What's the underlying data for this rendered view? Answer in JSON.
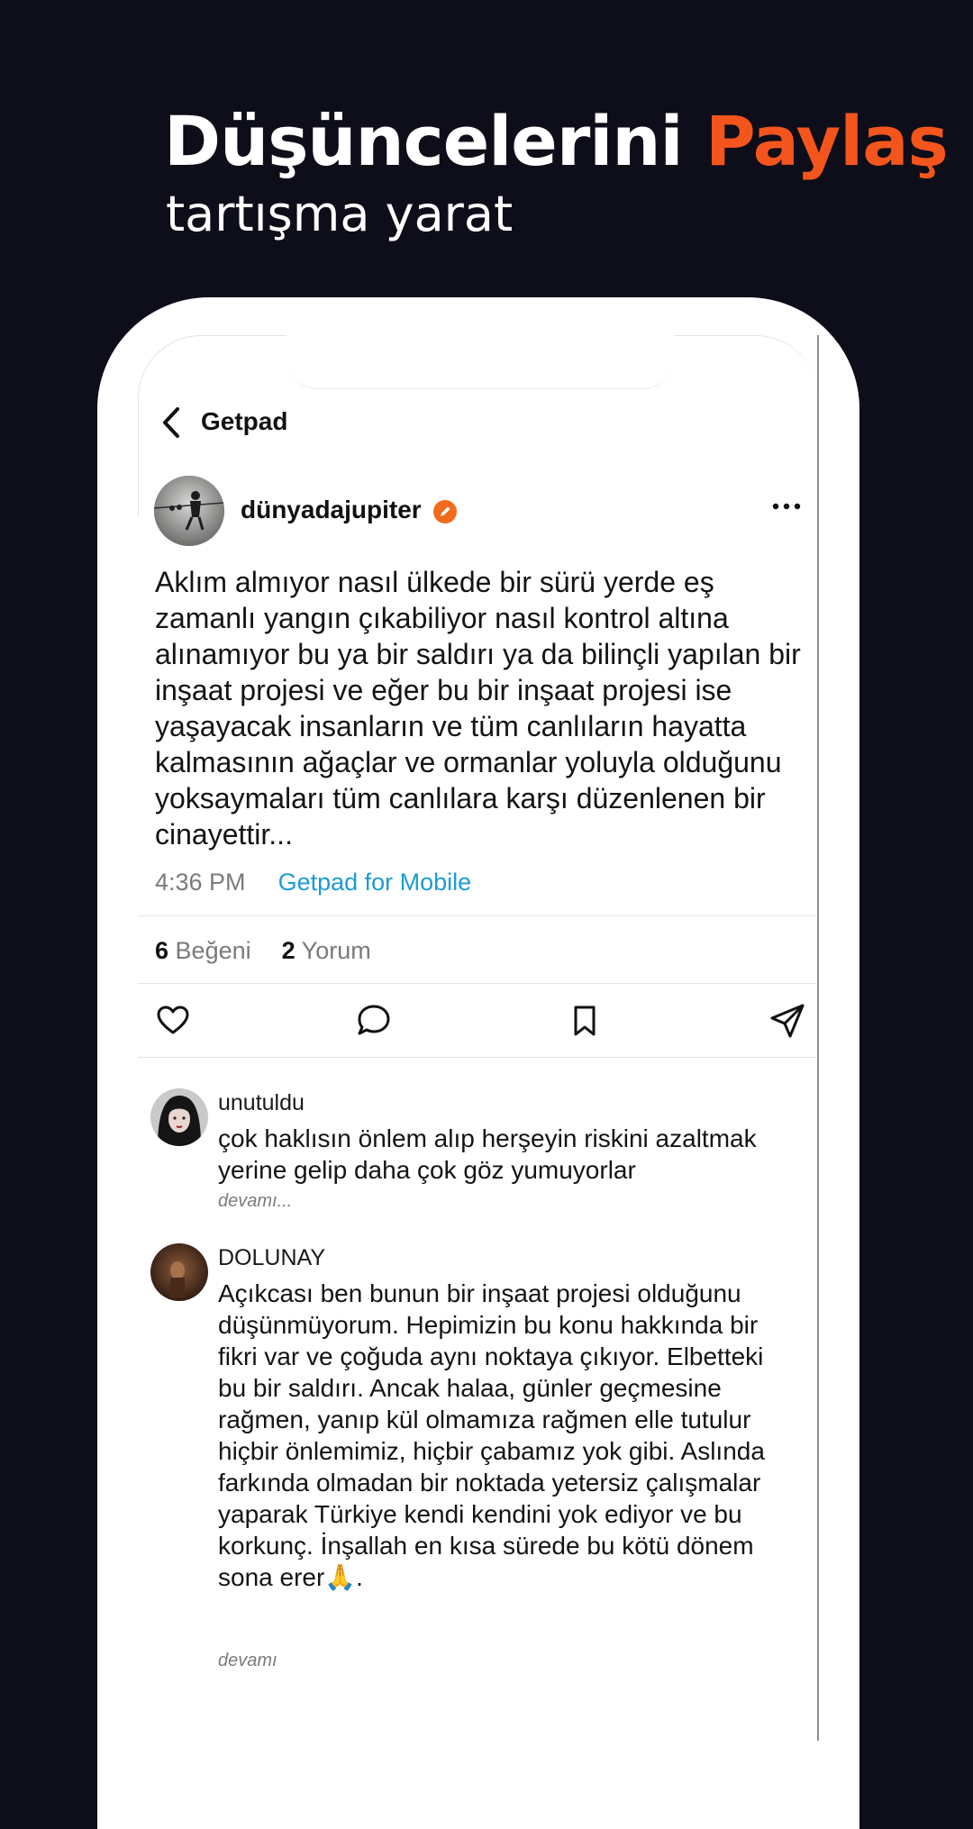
{
  "promo": {
    "headline_main": "Düşüncelerini",
    "headline_accent": "Paylaş",
    "subheadline": "tartışma yarat",
    "accent_color": "#f4551c",
    "background_color": "#0d0e19"
  },
  "nav": {
    "back_icon": "chevron-left-icon",
    "title": "Getpad"
  },
  "post": {
    "author": "dünyadajupiter",
    "verified_icon": "pencil-badge-icon",
    "more_icon": "more-horizontal-icon",
    "text": "Aklım almıyor nasıl ülkede bir sürü yerde eş zamanlı yangın çıkabiliyor nasıl kontrol altına alınamıyor bu ya bir saldırı ya da bilinçli yapılan bir inşaat projesi ve eğer bu bir inşaat projesi ise yaşayacak insanların ve tüm canlıların hayatta kalmasının ağaçlar ve ormanlar yoluyla olduğunu yoksaymaları tüm canlılara karşı düzenlenen bir cinayettir...",
    "time": "4:36 PM",
    "source": "Getpad for Mobile",
    "likes_count": "6",
    "likes_label": "Beğeni",
    "comments_count": "2",
    "comments_label": "Yorum"
  },
  "actions": {
    "like_icon": "heart-icon",
    "comment_icon": "speech-bubble-icon",
    "bookmark_icon": "bookmark-icon",
    "share_icon": "send-icon"
  },
  "comments": [
    {
      "user": "unutuldu",
      "text": "çok haklısın önlem alıp herşeyin riskini azaltmak yerine gelip daha çok göz yumuyorlar",
      "more": "devamı..."
    },
    {
      "user": "DOLUNAY",
      "text": "Açıkcası ben bunun bir inşaat projesi olduğunu düşünmüyorum. Hepimizin bu konu hakkında bir fikri var ve çoğuda aynı noktaya çıkıyor. Elbetteki bu bir saldırı. Ancak halaa, günler geçmesine rağmen, yanıp kül olmamıza rağmen elle tutulur hiçbir önlemimiz, hiçbir çabamız yok gibi. Aslında farkında olmadan bir noktada yetersiz çalışmalar yaparak Türkiye kendi kendini yok ediyor ve bu korkunç. İnşallah en kısa sürede bu kötü dönem sona erer🙏.",
      "more": "devamı"
    }
  ]
}
